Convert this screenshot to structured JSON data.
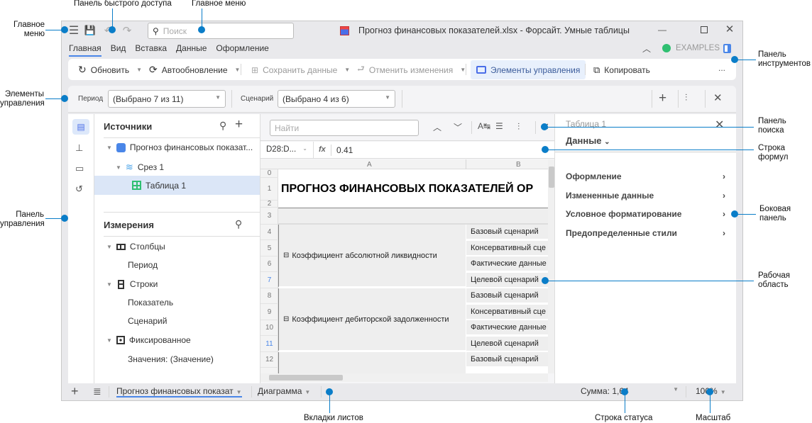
{
  "window": {
    "title": "Прогноз финансовых показателей.xlsx - Форсайт. Умные таблицы",
    "search_placeholder": "Поиск",
    "examples": "EXAMPLES"
  },
  "ribbon_tabs": [
    "Главная",
    "Вид",
    "Вставка",
    "Данные",
    "Оформление"
  ],
  "toolbar": {
    "refresh": "Обновить",
    "autorefresh": "Автообновление",
    "save_data": "Сохранить данные",
    "cancel_changes": "Отменить изменения",
    "controls": "Элементы управления",
    "copy": "Копировать",
    "more": "..."
  },
  "controls": {
    "period_label": "Период",
    "period_value": "(Выбрано 7 из 11)",
    "scenario_label": "Сценарий",
    "scenario_value": "(Выбрано 4 из 6)"
  },
  "sources": {
    "title": "Источники",
    "items": [
      "Прогноз финансовых показат...",
      "Срез 1",
      "Таблица 1"
    ]
  },
  "dimensions": {
    "title": "Измерения",
    "columns": "Столбцы",
    "period": "Период",
    "rows": "Строки",
    "indicator": "Показатель",
    "scenario": "Сценарий",
    "fixed": "Фиксированное",
    "values": "Значения: (Значение)"
  },
  "search_panel": {
    "placeholder": "Найти"
  },
  "formula": {
    "cell_ref": "D28:D...",
    "fx": "fx",
    "value": "0.41"
  },
  "grid": {
    "columns": [
      "A",
      "B"
    ],
    "row_numbers": [
      "0",
      "1",
      "2",
      "3",
      "4",
      "5",
      "6",
      "7",
      "8",
      "9",
      "10",
      "11",
      "12"
    ],
    "title": "ПРОГНОЗ ФИНАНСОВЫХ ПОКАЗАТЕЛЕЙ ОР",
    "group1": "Коэффициент абсолютной ликвидности",
    "group2": "Коэффициент дебиторской задолженности",
    "scenarios": [
      "Базовый сценарий",
      "Консервативный сце",
      "Фактические данные",
      "Целевой сценарий",
      "Базовый сценарий",
      "Консервативный сце",
      "Фактические данные",
      "Целевой сценарий",
      "Базовый сценарий"
    ]
  },
  "side_panel": {
    "object": "Таблица 1",
    "section": "Данные",
    "items": [
      "Оформление",
      "Измененные данные",
      "Условное форматирование",
      "Предопределенные стили"
    ]
  },
  "status": {
    "sheet1": "Прогноз финансовых показат",
    "sheet2": "Диаграмма",
    "sum": "Сумма: 1,64",
    "zoom": "100%"
  },
  "annotations": {
    "main_menu_left": "Главное меню",
    "quick_access": "Панель быстрого доступа",
    "main_menu_top": "Главное меню",
    "controls": "Элементы управления",
    "control_panel": "Панель управления",
    "toolbar": "Панель инструментов",
    "search_panel": "Панель поиска",
    "formula_bar": "Строка формул",
    "side_panel": "Боковая панель",
    "work_area": "Рабочая область",
    "sheet_tabs": "Вкладки листов",
    "status_bar": "Строка статуса",
    "zoom": "Масштаб"
  },
  "colors": {
    "accent": "#4a86e8",
    "annotation": "#0a7dc8",
    "status_online": "#2fbf71"
  }
}
